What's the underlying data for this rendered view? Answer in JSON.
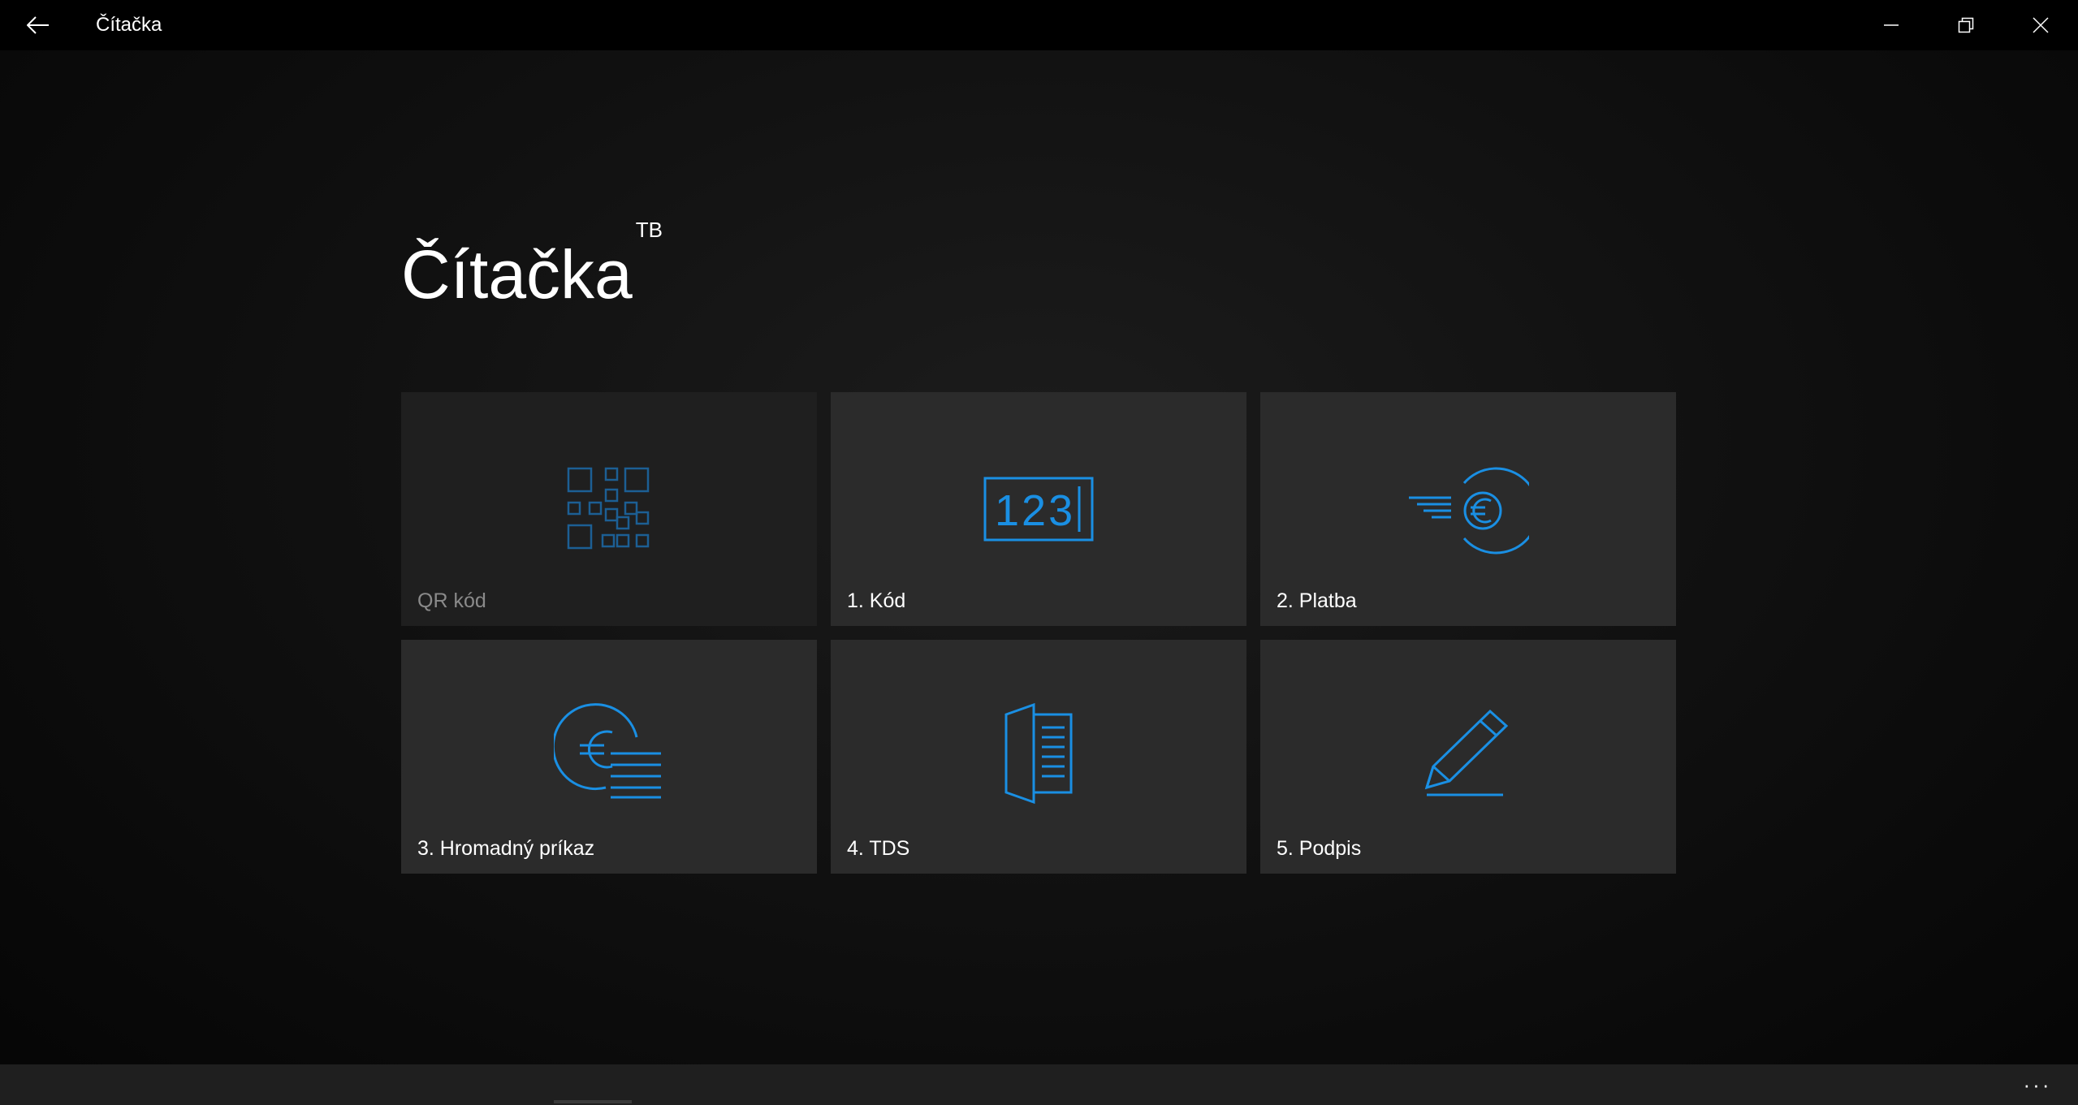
{
  "window": {
    "title": "Čítačka"
  },
  "header": {
    "title": "Čítačka",
    "superscript": "TB"
  },
  "tiles": [
    {
      "label": "QR kód",
      "icon": "qr-code-icon",
      "enabled": false
    },
    {
      "label": "1. Kód",
      "icon": "numeric-code-icon",
      "enabled": true
    },
    {
      "label": "2. Platba",
      "icon": "euro-payment-icon",
      "enabled": true
    },
    {
      "label": "3. Hromadný príkaz",
      "icon": "bulk-euro-order-icon",
      "enabled": true
    },
    {
      "label": "4. TDS",
      "icon": "tds-document-icon",
      "enabled": true
    },
    {
      "label": "5. Podpis",
      "icon": "pen-signature-icon",
      "enabled": true
    }
  ],
  "numeric_icon_text": "123",
  "appbar": {
    "more_label": "···"
  },
  "colors": {
    "accent": "#1a8fe3",
    "tile_bg": "#2b2b2b",
    "tile_disabled_bg": "#1f1f1f",
    "disabled_icon": "#1c5f94",
    "titlebar_bg": "#000000"
  }
}
